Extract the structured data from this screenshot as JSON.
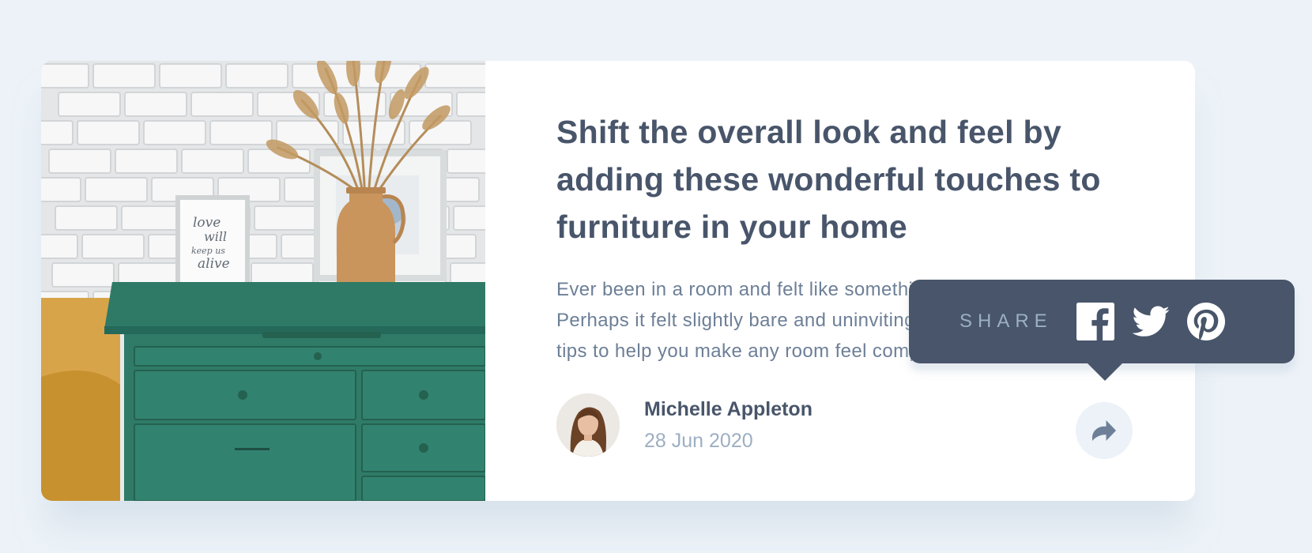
{
  "article": {
    "title": "Shift the overall look and feel by adding these wonderful touches to furniture in your home",
    "excerpt": "Ever been in a room and felt like something was missing? Perhaps it felt slightly bare and uninviting. I’ve got some simple tips to help you make any room feel complete."
  },
  "author": {
    "name": "Michelle Appleton",
    "date": "28 Jun 2020"
  },
  "share": {
    "label": "SHARE",
    "icons": [
      "facebook-icon",
      "twitter-icon",
      "pinterest-icon"
    ],
    "button_icon": "share-icon"
  },
  "image": {
    "frame_text": [
      "love",
      "will",
      "keep us",
      "alive"
    ]
  },
  "colors": {
    "background": "#ecf2f8",
    "title": "#48556a",
    "text": "#6d7f97",
    "muted": "#9dafc2",
    "tooltip": "#48556a",
    "dresser": "#2f7b68"
  }
}
